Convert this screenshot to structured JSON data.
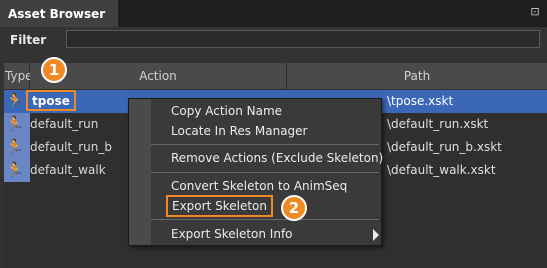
{
  "window": {
    "tab_title": "Asset Browser",
    "pin_icon": "pin-icon"
  },
  "filter": {
    "label": "Filter",
    "value": "",
    "placeholder": ""
  },
  "table": {
    "headers": {
      "type": "Type",
      "action": "Action",
      "path": "Path"
    },
    "rows": [
      {
        "icon": "skeleton-run-icon",
        "action": "tpose",
        "path": "\\tpose.xskt",
        "selected": true
      },
      {
        "icon": "skeleton-run-icon",
        "action": "default_run",
        "path": "\\default_run.xskt",
        "selected": false
      },
      {
        "icon": "skeleton-run-icon",
        "action": "default_run_b",
        "path": "\\default_run_b.xskt",
        "selected": false
      },
      {
        "icon": "skeleton-run-icon",
        "action": "default_walk",
        "path": "\\default_walk.xskt",
        "selected": false
      }
    ]
  },
  "context_menu": {
    "items": [
      "Copy Action Name",
      "Locate In Res Manager",
      "Remove Actions (Exclude Skeleton)",
      "Convert Skeleton to AnimSeq",
      "Export Skeleton",
      "Export Skeleton Info"
    ]
  },
  "callouts": {
    "one": "1",
    "two": "2"
  },
  "colors": {
    "accent": "#f08a24",
    "selection": "#3c67b7"
  }
}
